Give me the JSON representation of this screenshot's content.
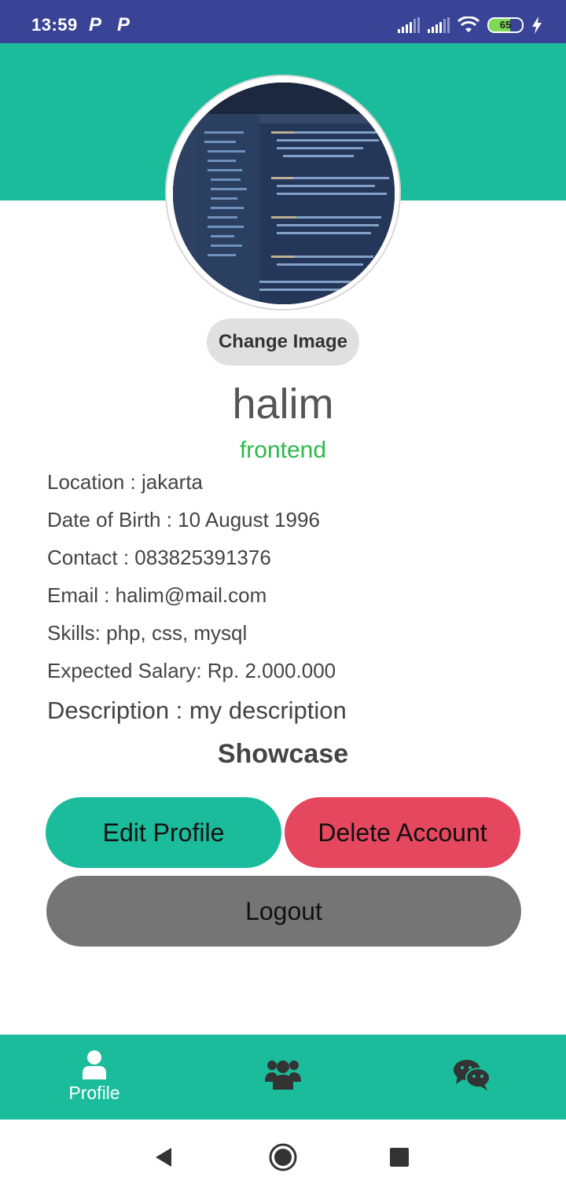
{
  "status_bar": {
    "time": "13:59",
    "notification_icons": [
      "P",
      "P"
    ],
    "battery_level": "65",
    "battery_percent": 65,
    "icons": [
      "signal-icon",
      "signal-icon",
      "wifi-icon",
      "battery-icon",
      "charging-bolt-icon"
    ]
  },
  "profile": {
    "change_image_label": "Change Image",
    "name": "halim",
    "role": "frontend",
    "details": {
      "location": "Location : jakarta",
      "dob": "Date of Birth : 10 August 1996",
      "contact": "Contact : 083825391376",
      "email": "Email : halim@mail.com",
      "skills": "Skills: php, css, mysql",
      "salary": "Expected Salary: Rp. 2.000.000",
      "description": "Description : my description"
    },
    "showcase_title": "Showcase"
  },
  "actions": {
    "edit_label": "Edit Profile",
    "delete_label": "Delete Account",
    "logout_label": "Logout"
  },
  "bottom_nav": {
    "items": [
      {
        "icon": "user-icon",
        "label": "Profile"
      },
      {
        "icon": "users-group-icon",
        "label": ""
      },
      {
        "icon": "chat-icon",
        "label": ""
      }
    ]
  },
  "colors": {
    "status_bar": "#3a4496",
    "accent": "#1bbc9b",
    "danger": "#e5475f",
    "neutral": "#757575",
    "role_text": "#2db84b"
  }
}
